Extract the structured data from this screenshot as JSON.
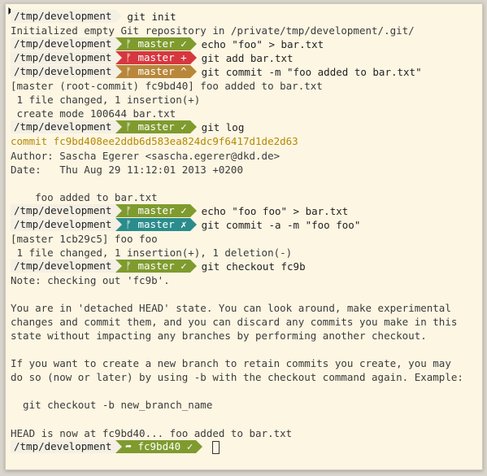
{
  "lines": [
    {
      "type": "prompt",
      "dir": "/tmp/development",
      "branch": "",
      "status": "",
      "color": "",
      "cmd": "git init"
    },
    {
      "type": "out",
      "text": "Initialized empty Git repository in /private/tmp/development/.git/"
    },
    {
      "type": "prompt",
      "dir": "/tmp/development",
      "branch": "master",
      "status": "✓",
      "color": "green",
      "cmd": "echo \"foo\" > bar.txt"
    },
    {
      "type": "prompt",
      "dir": "/tmp/development",
      "branch": "master",
      "status": "+",
      "color": "red",
      "cmd": "git add bar.txt"
    },
    {
      "type": "prompt",
      "dir": "/tmp/development",
      "branch": "master",
      "status": "^",
      "color": "orange",
      "cmd": "git commit -m \"foo added to bar.txt\""
    },
    {
      "type": "out",
      "text": "[master (root-commit) fc9bd40] foo added to bar.txt"
    },
    {
      "type": "out",
      "text": " 1 file changed, 1 insertion(+)"
    },
    {
      "type": "out",
      "text": " create mode 100644 bar.txt"
    },
    {
      "type": "prompt",
      "dir": "/tmp/development",
      "branch": "master",
      "status": "✓",
      "color": "green",
      "cmd": "git log"
    },
    {
      "type": "out",
      "text": "commit fc9bd408ee2ddb6d583ea824dc9f6417d1de2d63",
      "style": "yellow"
    },
    {
      "type": "out",
      "text": "Author: Sascha Egerer <sascha.egerer@dkd.de>"
    },
    {
      "type": "out",
      "text": "Date:   Thu Aug 29 11:12:01 2013 +0200"
    },
    {
      "type": "out",
      "text": ""
    },
    {
      "type": "out",
      "text": "    foo added to bar.txt"
    },
    {
      "type": "prompt",
      "dir": "/tmp/development",
      "branch": "master",
      "status": "✓",
      "color": "green",
      "cmd": "echo \"foo foo\" > bar.txt"
    },
    {
      "type": "prompt",
      "dir": "/tmp/development",
      "branch": "master",
      "status": "✗",
      "color": "teal",
      "cmd": "git commit -a -m \"foo foo\""
    },
    {
      "type": "out",
      "text": "[master 1cb29c5] foo foo"
    },
    {
      "type": "out",
      "text": " 1 file changed, 1 insertion(+), 1 deletion(-)"
    },
    {
      "type": "prompt",
      "dir": "/tmp/development",
      "branch": "master",
      "status": "✓",
      "color": "green",
      "cmd": "git checkout fc9b"
    },
    {
      "type": "out",
      "text": "Note: checking out 'fc9b'."
    },
    {
      "type": "out",
      "text": ""
    },
    {
      "type": "out",
      "text": "You are in 'detached HEAD' state. You can look around, make experimental"
    },
    {
      "type": "out",
      "text": "changes and commit them, and you can discard any commits you make in this"
    },
    {
      "type": "out",
      "text": "state without impacting any branches by performing another checkout."
    },
    {
      "type": "out",
      "text": ""
    },
    {
      "type": "out",
      "text": "If you want to create a new branch to retain commits you create, you may"
    },
    {
      "type": "out",
      "text": "do so (now or later) by using -b with the checkout command again. Example:"
    },
    {
      "type": "out",
      "text": ""
    },
    {
      "type": "out",
      "text": "  git checkout -b new_branch_name"
    },
    {
      "type": "out",
      "text": ""
    },
    {
      "type": "out",
      "text": "HEAD is now at fc9bd40... foo added to bar.txt"
    },
    {
      "type": "prompt",
      "dir": "/tmp/development",
      "branch": "➦ fc9bd40",
      "status": "✓",
      "color": "green",
      "cmd": "",
      "cursor": true
    }
  ]
}
